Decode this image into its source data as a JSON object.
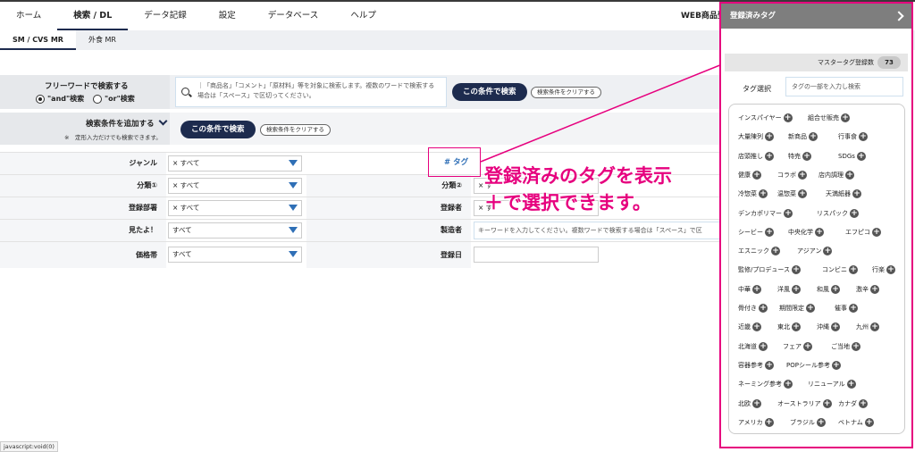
{
  "nav": {
    "items": [
      "ホーム",
      "検索 / DL",
      "データ記録",
      "設定",
      "データベース",
      "ヘルプ"
    ],
    "active_index": 1,
    "right_link": "WEB商品登"
  },
  "subnav": {
    "items": [
      "SM / CVS MR",
      "外食 MR"
    ],
    "active_index": 0
  },
  "freeword": {
    "title": "フリーワードで検索する",
    "radio_and": "\"and\"検索",
    "radio_or": "\"or\"検索",
    "placeholder": "｜「商品名」「コメント」「原材料」等を対象に検索します。複数のワードで検索する場合は「スペース」で区切ってください。",
    "search_button": "この条件で検索",
    "clear_button": "検索条件をクリアする"
  },
  "add_condition": {
    "title": "検索条件を追加する",
    "note": "※　定形入力だけでも検索できます。",
    "search_button": "この条件で検索",
    "clear_button": "検索条件をクリアする"
  },
  "form": {
    "genre_label": "ジャンル",
    "genre_value": "× すべて",
    "class1_label": "分類①",
    "class1_value": "× すべて",
    "class2_label": "分類②",
    "class2_value": "× す",
    "dept_label": "登録部署",
    "dept_value": "× すべて",
    "registrant_label": "登録者",
    "registrant_value": "× す",
    "mitayo_label": "見たよ！",
    "mitayo_value": "すべて",
    "maker_label": "製造者",
    "maker_placeholder": "キーワードを入力してください。複数ワードで検索する場合は「スペース」で区",
    "price_label": "価格帯",
    "price_value": "すべて",
    "regdate_label": "登録日",
    "tag_link": "# タグ"
  },
  "callout": {
    "line1": "登録済みのタグを表示",
    "line2": "＋で選択できます。"
  },
  "status_bar": "javascript:void(0)",
  "panel": {
    "title": "登録済みタグ",
    "master_label": "マスタータグ登録数",
    "master_count": "73",
    "tag_select_label": "タグ選択",
    "tag_input_placeholder": "タグの一部を入力し検索",
    "rows": [
      [
        "インスパイヤー",
        "組合せ販売"
      ],
      [
        "大量陳列",
        "新商品",
        "行事食"
      ],
      [
        "店頭推し",
        "特売",
        "SDGs"
      ],
      [
        "健康",
        "コラボ",
        "店内調理"
      ],
      [
        "冷惣菜",
        "温惣菜",
        "天満紙器"
      ],
      [
        "デンカポリマー",
        "リスパック"
      ],
      [
        "シービー",
        "中央化学",
        "エフピコ"
      ],
      [
        "エスニック",
        "アジアン"
      ],
      [
        "監修/プロデュース",
        "コンビニ",
        "行楽"
      ],
      [
        "中華",
        "洋風",
        "和風",
        "激辛"
      ],
      [
        "骨付き",
        "期間限定",
        "催事"
      ],
      [
        "近畿",
        "東北",
        "沖縄",
        "九州"
      ],
      [
        "北海道",
        "フェア",
        "ご当地"
      ],
      [
        "容器参考",
        "POPシール参考"
      ],
      [
        "ネーミング参考",
        "リニューアル"
      ],
      [
        "北欧",
        "オーストラリア",
        "カナダ"
      ],
      [
        "アメリカ",
        "ブラジル",
        "ベトナム"
      ]
    ]
  }
}
